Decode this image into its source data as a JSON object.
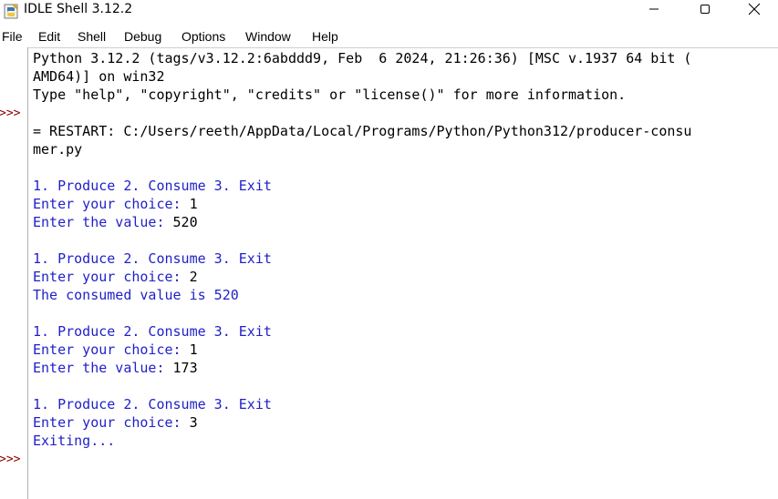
{
  "window": {
    "title": "IDLE Shell 3.12.2",
    "minimize_label": "—",
    "maximize_label": "☐",
    "close_label": "✕"
  },
  "menu": [
    "File",
    "Edit",
    "Shell",
    "Debug",
    "Options",
    "Window",
    "Help"
  ],
  "prompt": ">>>",
  "colors": {
    "output_blue": "#1f1fc9",
    "prompt_red": "#8b0000",
    "text_black": "#000000"
  },
  "shell": {
    "banner": [
      "Python 3.12.2 (tags/v3.12.2:6abddd9, Feb  6 2024, 21:26:36) [MSC v.1937 64 bit (",
      "AMD64)] on win32",
      "Type \"help\", \"copyright\", \"credits\" or \"license()\" for more information."
    ],
    "restart": [
      "= RESTART: C:/Users/reeth/AppData/Local/Programs/Python/Python312/producer-consu",
      "mer.py"
    ],
    "session": [
      {
        "menu": "1. Produce 2. Consume 3. Exit",
        "choice_prompt": "Enter your choice: ",
        "choice": "1",
        "value_prompt": "Enter the value: ",
        "value": "520"
      },
      {
        "menu": "1. Produce 2. Consume 3. Exit",
        "choice_prompt": "Enter your choice: ",
        "choice": "2",
        "result": "The consumed value is 520"
      },
      {
        "menu": "1. Produce 2. Consume 3. Exit",
        "choice_prompt": "Enter your choice: ",
        "choice": "1",
        "value_prompt": "Enter the value: ",
        "value": "173"
      },
      {
        "menu": "1. Produce 2. Consume 3. Exit",
        "choice_prompt": "Enter your choice: ",
        "choice": "3",
        "result": "Exiting..."
      }
    ]
  }
}
